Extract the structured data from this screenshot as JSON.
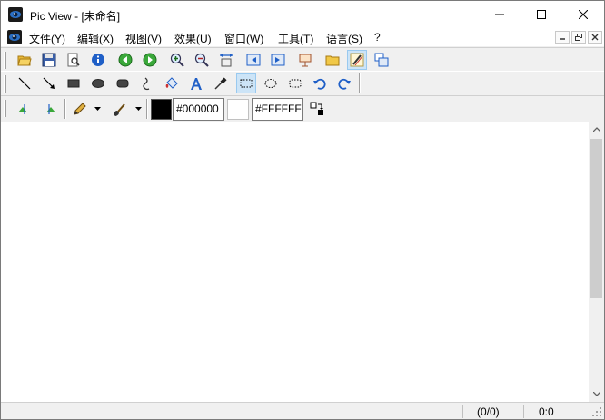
{
  "window": {
    "title": "Pic View - [未命名]"
  },
  "menu": {
    "items": [
      {
        "label": "文件(Y)"
      },
      {
        "label": "编辑(X)"
      },
      {
        "label": "视图(V)"
      },
      {
        "label": "效果(U)"
      },
      {
        "label": "窗口(W)"
      },
      {
        "label": "工具(T)"
      },
      {
        "label": "语言(S)"
      },
      {
        "label": "?"
      }
    ]
  },
  "toolbar_main": {
    "icons": [
      "open-folder-icon",
      "save-icon",
      "print-preview-icon",
      "info-icon",
      "previous-icon",
      "next-icon",
      "zoom-in-icon",
      "zoom-out-icon",
      "fit-size-icon",
      "first-image-icon",
      "last-image-icon",
      "slideshow-icon",
      "browse-folder-icon",
      "paint-mode-icon",
      "window-switch-icon"
    ]
  },
  "toolbar_draw": {
    "icons": [
      "line-tool-icon",
      "arrow-tool-icon",
      "rectangle-tool-icon",
      "ellipse-tool-icon",
      "rounded-rect-tool-icon",
      "freehand-tool-icon",
      "fill-tool-icon",
      "text-tool-icon",
      "color-picker-icon",
      "rect-select-icon",
      "ellipse-select-icon",
      "round-select-icon",
      "undo-icon",
      "redo-icon"
    ]
  },
  "toolbar_color": {
    "foreground_color": "#000000",
    "background_color": "#FFFFFF"
  },
  "status": {
    "position": "(0/0)",
    "zoom": "0:0"
  },
  "colors": {
    "accent_active": "#cce4f7",
    "chrome": "#f0f0f0"
  }
}
